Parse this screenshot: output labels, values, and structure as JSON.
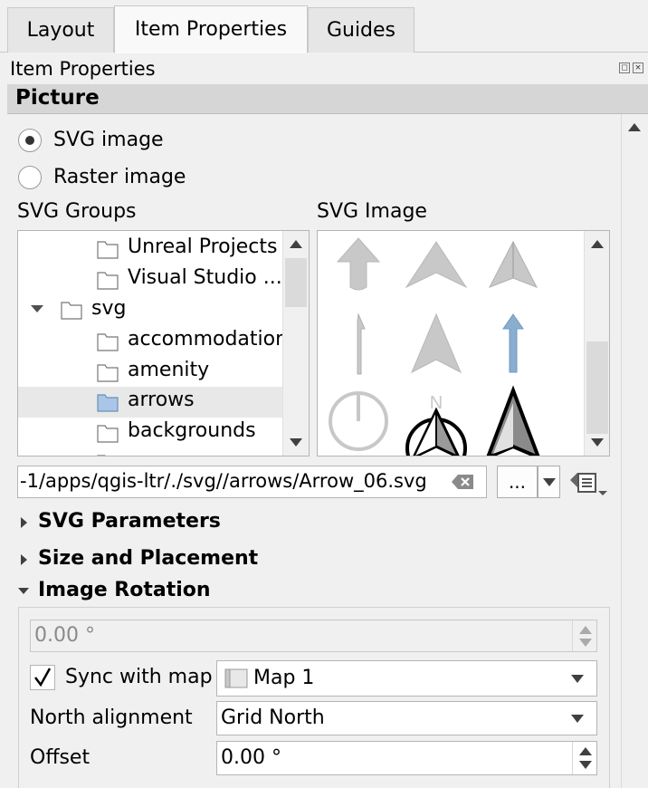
{
  "tabs": [
    {
      "label": "Layout"
    },
    {
      "label": "Item Properties"
    },
    {
      "label": "Guides"
    }
  ],
  "panel": {
    "title": "Item Properties"
  },
  "section": {
    "title": "Picture"
  },
  "radios": {
    "svg": "SVG image",
    "raster": "Raster image"
  },
  "svg_groups": {
    "label": "SVG Groups",
    "items": [
      {
        "label": "Unreal Projects"
      },
      {
        "label": "Visual Studio ..."
      },
      {
        "label": "svg"
      },
      {
        "label": "accommodation"
      },
      {
        "label": "amenity"
      },
      {
        "label": "arrows"
      },
      {
        "label": "backgrounds"
      }
    ]
  },
  "svg_image": {
    "label": "SVG Image",
    "north_letter": "N"
  },
  "path": {
    "value": "-1/apps/qgis-ltr/./svg//arrows/Arrow_06.svg",
    "browse_label": "..."
  },
  "collapsibles": {
    "svg_params": "SVG Parameters",
    "size_placement": "Size and Placement",
    "image_rotation": "Image Rotation"
  },
  "rotation": {
    "value": "0.00 °",
    "sync_label": "Sync with map",
    "map_value": "Map 1",
    "north_label": "North alignment",
    "north_value": "Grid North",
    "offset_label": "Offset",
    "offset_value": "0.00 °"
  },
  "colors": {
    "selected_folder": "#a9c6e8",
    "arrow_gray": "#c8c8c8",
    "arrow_blue": "#88aed0"
  }
}
